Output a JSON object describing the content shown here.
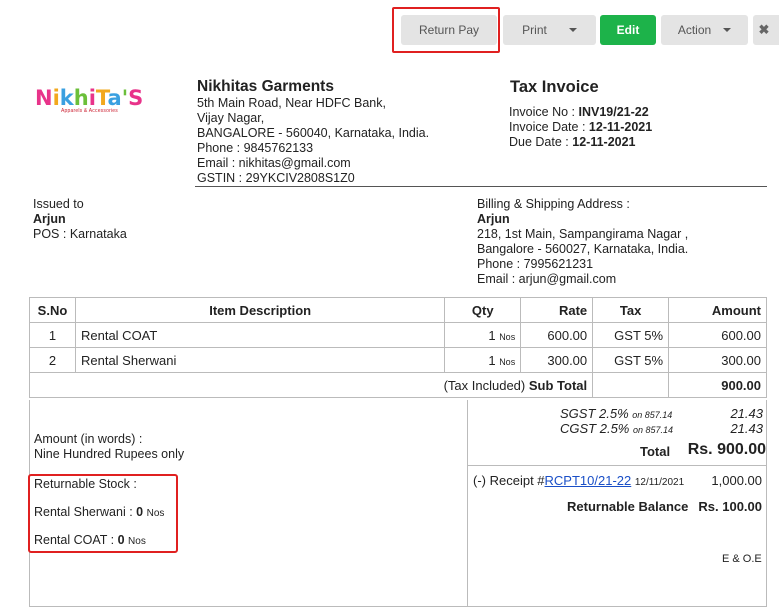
{
  "toolbar": {
    "return_pay": "Return Pay",
    "print": "Print",
    "edit": "Edit",
    "action": "Action",
    "close": "✖"
  },
  "logo": {
    "text": "NikhiTa'S",
    "tagline": "Apparels & Accessories"
  },
  "company": {
    "name": "Nikhitas Garments",
    "address1": "5th Main Road, Near HDFC Bank,",
    "address2": "Vijay Nagar,",
    "address3": "BANGALORE - 560040, Karnataka, India.",
    "phone": "Phone : 9845762133",
    "email": "Email : nikhitas@gmail.com",
    "gstin": "GSTIN : 29YKCIV2808S1Z0"
  },
  "invoice": {
    "title": "Tax Invoice",
    "no_label": "Invoice No  :",
    "no_value": "INV19/21-22",
    "date_label": "Invoice Date  :",
    "date_value": "12-11-2021",
    "due_label": "Due Date  :",
    "due_value": "12-11-2021"
  },
  "issued": {
    "label": "Issued to",
    "name": "Arjun",
    "pos": "POS : Karnataka"
  },
  "billing": {
    "label": "Billing & Shipping Address :",
    "name": "Arjun",
    "address1": "218, 1st Main, Sampangirama Nagar ,",
    "address2": "Bangalore - 560027, Karnataka, India.",
    "phone": "Phone : 7995621231",
    "email": "Email : arjun@gmail.com"
  },
  "table": {
    "headers": [
      "S.No",
      "Item Description",
      "Qty",
      "Rate",
      "Tax",
      "Amount"
    ],
    "rows": [
      {
        "sno": "1",
        "desc": "Rental COAT",
        "qty": "1",
        "unit": "Nos",
        "rate": "600.00",
        "tax": "GST 5%",
        "amount": "600.00"
      },
      {
        "sno": "2",
        "desc": "Rental Sherwani",
        "qty": "1",
        "unit": "Nos",
        "rate": "300.00",
        "tax": "GST 5%",
        "amount": "300.00"
      }
    ],
    "subtotal_prefix": "(Tax Included)",
    "subtotal_label": "Sub Total",
    "subtotal_value": "900.00"
  },
  "taxes": {
    "sgst_label": "SGST 2.5%",
    "sgst_on": "on 857.14",
    "sgst_value": "21.43",
    "cgst_label": "CGST 2.5%",
    "cgst_on": "on 857.14",
    "cgst_value": "21.43",
    "total_label": "Total",
    "total_value": "Rs. 900.00"
  },
  "words": {
    "label": "Amount (in words) :",
    "value": "Nine Hundred Rupees only"
  },
  "receipt": {
    "prefix": "(-) Receipt #",
    "link": "RCPT10/21-22",
    "date": "12/11/2021",
    "amount": "1,000.00",
    "balance_label": "Returnable Balance",
    "balance_value": "Rs. 100.00"
  },
  "returnable": {
    "title": "Returnable Stock :",
    "item1_label": "Rental Sherwani :",
    "item1_qty": "0",
    "item1_unit": "Nos",
    "item2_label": "Rental COAT :",
    "item2_qty": "0",
    "item2_unit": "Nos"
  },
  "eoe": "E & O.E",
  "colors": {
    "edit_green": "#1db34a",
    "highlight_red": "#e02020",
    "link_blue": "#1a4fc7"
  }
}
